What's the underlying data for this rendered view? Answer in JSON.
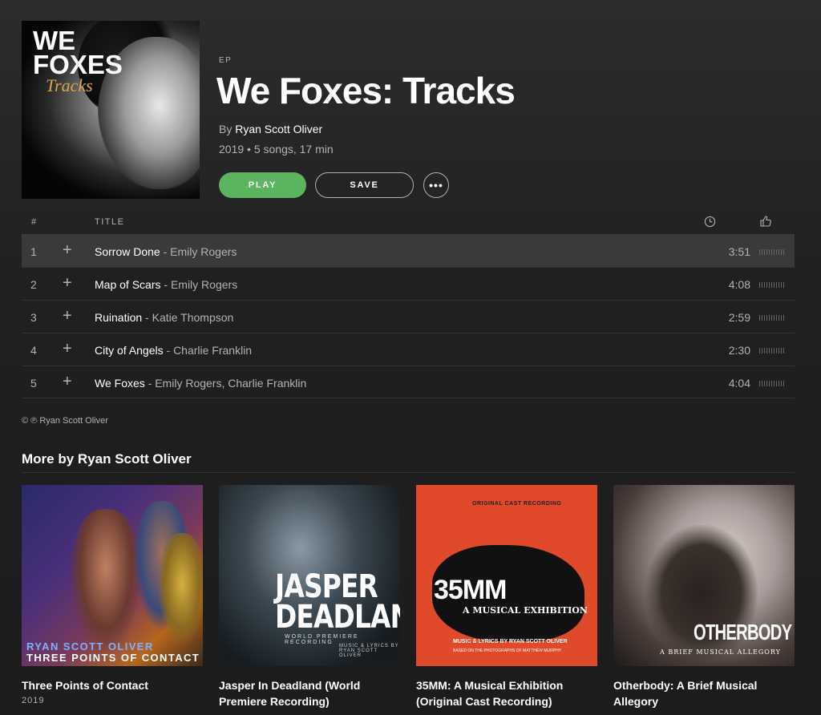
{
  "album": {
    "cover_line1": "WE",
    "cover_line2": "FOXES",
    "cover_line3": "Tracks",
    "type_label": "EP",
    "title": "We Foxes: Tracks",
    "by_prefix": "By",
    "artist": "Ryan Scott Oliver",
    "meta": "2019 • 5 songs, 17 min"
  },
  "actions": {
    "play_label": "PLAY",
    "save_label": "SAVE",
    "more_label": "•••"
  },
  "tracklist": {
    "header_num": "#",
    "header_title": "TITLE",
    "add_glyph": "+",
    "separator": " - ",
    "tracks": [
      {
        "num": "1",
        "title": "Sorrow Done",
        "artists": "Emily Rogers",
        "duration": "3:51"
      },
      {
        "num": "2",
        "title": "Map of Scars",
        "artists": "Emily Rogers",
        "duration": "4:08"
      },
      {
        "num": "3",
        "title": "Ruination",
        "artists": "Katie Thompson",
        "duration": "2:59"
      },
      {
        "num": "4",
        "title": "City of Angels",
        "artists": "Charlie Franklin",
        "duration": "2:30"
      },
      {
        "num": "5",
        "title": "We Foxes",
        "artists": "Emily Rogers, Charlie Franklin",
        "duration": "4:04"
      }
    ]
  },
  "copyright": "© ℗ Ryan Scott Oliver",
  "more": {
    "heading": "More by Ryan Scott Oliver",
    "cards": [
      {
        "title": "Three Points of Contact",
        "year": "2019",
        "art_line1": "RYAN SCOTT OLIVER",
        "art_line2": "THREE POINTS OF CONTACT"
      },
      {
        "title": "Jasper In Deadland (World Premiere Recording)",
        "art_line1": "JASPER",
        "art_line2": "DEADLAND",
        "art_line3": "WORLD PREMIERE RECORDING",
        "art_line4": "MUSIC & LYRICS BY RYAN SCOTT OLIVER"
      },
      {
        "title": "35MM: A Musical Exhibition (Original Cast Recording)",
        "art_line1": "ORIGINAL CAST RECORDING",
        "art_line2": "35MM",
        "art_line3": "A MUSICAL EXHIBITION",
        "art_line4": "MUSIC & LYRICS BY RYAN SCOTT OLIVER",
        "art_line5": "BASED ON THE PHOTOGRAPHS OF MATTHEW MURPHY"
      },
      {
        "title": "Otherbody: A Brief Musical Allegory",
        "art_line1": "OTHERBODY",
        "art_line2": "A BRIEF MUSICAL ALLEGORY"
      }
    ]
  },
  "colors": {
    "play_green": "#5ab55e",
    "background": "#202020",
    "row_highlight": "#3a3a3a"
  }
}
